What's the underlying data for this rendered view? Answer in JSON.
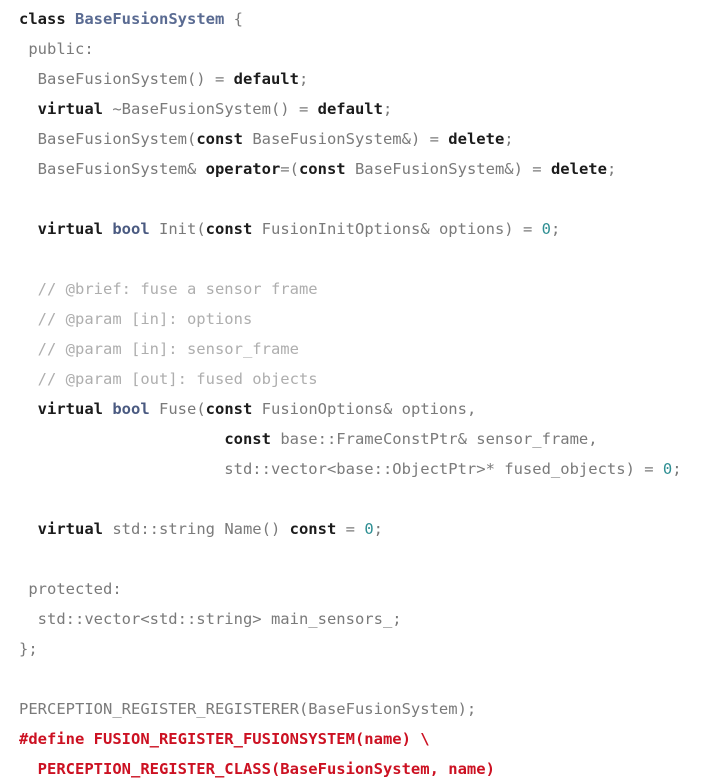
{
  "document": {
    "language": "cpp",
    "background_color": "#ffffff",
    "colors": {
      "keyword": "#1b1b1b",
      "type": "#4a5a81",
      "class_name": "#5a6b92",
      "plain": "#7a7a7a",
      "comment": "#aeaeae",
      "number": "#2f8f93",
      "macro": "#cc1122"
    }
  },
  "lines": [
    {
      "id": "line-1",
      "tokens": [
        {
          "t": "class",
          "k": "kw"
        },
        {
          "t": " ",
          "k": "plain"
        },
        {
          "t": "BaseFusionSystem",
          "k": "classname"
        },
        {
          "t": " {",
          "k": "plain"
        }
      ]
    },
    {
      "id": "line-2",
      "tokens": [
        {
          "t": " public:",
          "k": "plain"
        }
      ]
    },
    {
      "id": "line-3",
      "tokens": [
        {
          "t": "  BaseFusionSystem() = ",
          "k": "plain"
        },
        {
          "t": "default",
          "k": "kw"
        },
        {
          "t": ";",
          "k": "plain"
        }
      ]
    },
    {
      "id": "line-4",
      "tokens": [
        {
          "t": "  ",
          "k": "plain"
        },
        {
          "t": "virtual",
          "k": "kw"
        },
        {
          "t": " ~BaseFusionSystem() = ",
          "k": "plain"
        },
        {
          "t": "default",
          "k": "kw"
        },
        {
          "t": ";",
          "k": "plain"
        }
      ]
    },
    {
      "id": "line-5",
      "tokens": [
        {
          "t": "  BaseFusionSystem(",
          "k": "plain"
        },
        {
          "t": "const",
          "k": "kw"
        },
        {
          "t": " BaseFusionSystem&) = ",
          "k": "plain"
        },
        {
          "t": "delete",
          "k": "kw"
        },
        {
          "t": ";",
          "k": "plain"
        }
      ]
    },
    {
      "id": "line-6",
      "tokens": [
        {
          "t": "  BaseFusionSystem& ",
          "k": "plain"
        },
        {
          "t": "operator",
          "k": "kw"
        },
        {
          "t": "=(",
          "k": "plain"
        },
        {
          "t": "const",
          "k": "kw"
        },
        {
          "t": " BaseFusionSystem&) = ",
          "k": "plain"
        },
        {
          "t": "delete",
          "k": "kw"
        },
        {
          "t": ";",
          "k": "plain"
        }
      ]
    },
    {
      "id": "line-7",
      "blank": true,
      "tokens": []
    },
    {
      "id": "line-8",
      "tokens": [
        {
          "t": "  ",
          "k": "plain"
        },
        {
          "t": "virtual",
          "k": "kw"
        },
        {
          "t": " ",
          "k": "plain"
        },
        {
          "t": "bool",
          "k": "type"
        },
        {
          "t": " Init(",
          "k": "plain"
        },
        {
          "t": "const",
          "k": "kw"
        },
        {
          "t": " FusionInitOptions& options) = ",
          "k": "plain"
        },
        {
          "t": "0",
          "k": "number"
        },
        {
          "t": ";",
          "k": "plain"
        }
      ]
    },
    {
      "id": "line-9",
      "blank": true,
      "tokens": []
    },
    {
      "id": "line-10",
      "tokens": [
        {
          "t": "  // @brief: fuse a sensor frame",
          "k": "comment"
        }
      ]
    },
    {
      "id": "line-11",
      "tokens": [
        {
          "t": "  // @param [in]: options",
          "k": "comment"
        }
      ]
    },
    {
      "id": "line-12",
      "tokens": [
        {
          "t": "  // @param [in]: sensor_frame",
          "k": "comment"
        }
      ]
    },
    {
      "id": "line-13",
      "tokens": [
        {
          "t": "  // @param [out]: fused objects",
          "k": "comment"
        }
      ]
    },
    {
      "id": "line-14",
      "tokens": [
        {
          "t": "  ",
          "k": "plain"
        },
        {
          "t": "virtual",
          "k": "kw"
        },
        {
          "t": " ",
          "k": "plain"
        },
        {
          "t": "bool",
          "k": "type"
        },
        {
          "t": " Fuse(",
          "k": "plain"
        },
        {
          "t": "const",
          "k": "kw"
        },
        {
          "t": " FusionOptions& options,",
          "k": "plain"
        }
      ]
    },
    {
      "id": "line-15",
      "tokens": [
        {
          "t": "                      ",
          "k": "plain"
        },
        {
          "t": "const",
          "k": "kw"
        },
        {
          "t": " base::FrameConstPtr& sensor_frame,",
          "k": "plain"
        }
      ]
    },
    {
      "id": "line-16",
      "tokens": [
        {
          "t": "                      std::vector<base::ObjectPtr>* fused_objects) = ",
          "k": "plain"
        },
        {
          "t": "0",
          "k": "number"
        },
        {
          "t": ";",
          "k": "plain"
        }
      ]
    },
    {
      "id": "line-17",
      "blank": true,
      "tokens": []
    },
    {
      "id": "line-18",
      "tokens": [
        {
          "t": "  ",
          "k": "plain"
        },
        {
          "t": "virtual",
          "k": "kw"
        },
        {
          "t": " std::string Name() ",
          "k": "plain"
        },
        {
          "t": "const",
          "k": "kw"
        },
        {
          "t": " = ",
          "k": "plain"
        },
        {
          "t": "0",
          "k": "number"
        },
        {
          "t": ";",
          "k": "plain"
        }
      ]
    },
    {
      "id": "line-19",
      "blank": true,
      "tokens": []
    },
    {
      "id": "line-20",
      "tokens": [
        {
          "t": " protected:",
          "k": "plain"
        }
      ]
    },
    {
      "id": "line-21",
      "tokens": [
        {
          "t": "  std::vector<std::string> main_sensors_;",
          "k": "plain"
        }
      ]
    },
    {
      "id": "line-22",
      "tokens": [
        {
          "t": "};",
          "k": "plain"
        }
      ]
    },
    {
      "id": "line-23",
      "blank": true,
      "tokens": []
    },
    {
      "id": "line-24",
      "tokens": [
        {
          "t": "PERCEPTION_REGISTER_REGISTERER(BaseFusionSystem);",
          "k": "plain"
        }
      ]
    },
    {
      "id": "line-25",
      "tokens": [
        {
          "t": "#define FUSION_REGISTER_FUSIONSYSTEM(name) \\",
          "k": "macro"
        }
      ]
    },
    {
      "id": "line-26",
      "tokens": [
        {
          "t": "  PERCEPTION_REGISTER_CLASS(BaseFusionSystem, name)",
          "k": "macro"
        }
      ]
    }
  ]
}
